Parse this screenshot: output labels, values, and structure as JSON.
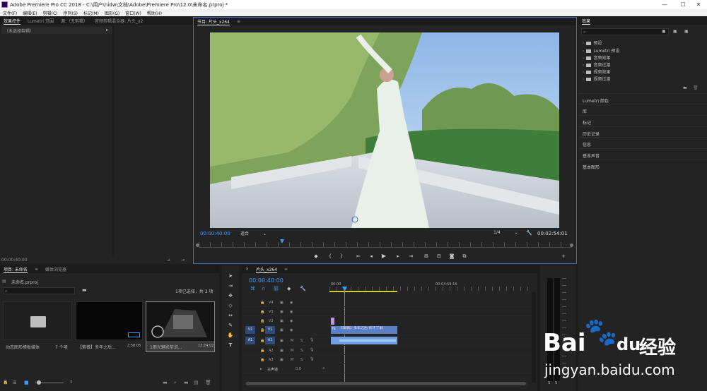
{
  "window": {
    "title": "Adobe Premiere Pro CC 2018 - C:\\用户\\nidw\\文档\\Adobe\\Premiere Pro\\12.0\\未命名.prproj *",
    "controls": [
      "—",
      "☐",
      "✕"
    ]
  },
  "menu": [
    "文件(F)",
    "编辑(E)",
    "剪辑(C)",
    "序列(S)",
    "标记(M)",
    "图形(G)",
    "窗口(W)",
    "帮助(H)"
  ],
  "source_panel": {
    "tabs": [
      "效果控件",
      "Lumetri 范围",
      "源:（无剪辑）",
      "音频剪辑混合器: 片头_x2"
    ],
    "no_clip": "（未选择剪辑）",
    "timecode": "00:00:40:00"
  },
  "program": {
    "title": "节目: 片头_x264",
    "timecode_left": "00:00:40:00",
    "fit": "适合",
    "resolution": "1/4",
    "timecode_right": "00:02:54:01",
    "colors": {
      "accent": "#3a9bff",
      "border": "#3a72c8"
    }
  },
  "effects": {
    "title": "效果",
    "items": [
      "预设",
      "Lumetri 预设",
      "音频效果",
      "音频过渡",
      "视频效果",
      "视频过渡"
    ],
    "sections": [
      "Lumetri 颜色",
      "库",
      "标记",
      "历史记录",
      "信息",
      "基本声音",
      "基本图形"
    ]
  },
  "project": {
    "tabs": [
      "项目: 未命名",
      "媒体浏览器"
    ],
    "file": "未命名.prproj",
    "selection": "1项已选择，共 3 项",
    "items": [
      {
        "label": "动态图形模板媒体",
        "meta": "7 个项",
        "kind": "bin"
      },
      {
        "label": "【紫薇】多年之后...",
        "meta": "2:58:05",
        "kind": "clip"
      },
      {
        "label": "1雨光魅影前说...",
        "meta": "13:24:02",
        "kind": "clip"
      }
    ]
  },
  "timeline": {
    "tab": "片头_x264",
    "timecode": "00:00:40:00",
    "ruler": [
      "00:00",
      "00:04:59:16"
    ],
    "video_tracks": [
      "V4",
      "V3",
      "V2",
      "V1"
    ],
    "audio_tracks": [
      "A1",
      "A2",
      "A3"
    ],
    "source_patch_v": "V1",
    "source_patch_a": "A1",
    "master_label": "主声道",
    "master_value": "0.0",
    "clip_video_label": "【紫薇】多年之后 你才了解",
    "ms": "M",
    "ss": "S"
  },
  "watermark": {
    "brand": "Bai",
    "paw": "🐾",
    "du": "du",
    "site_cn": "经验",
    "url": "jingyan.baidu.com"
  }
}
